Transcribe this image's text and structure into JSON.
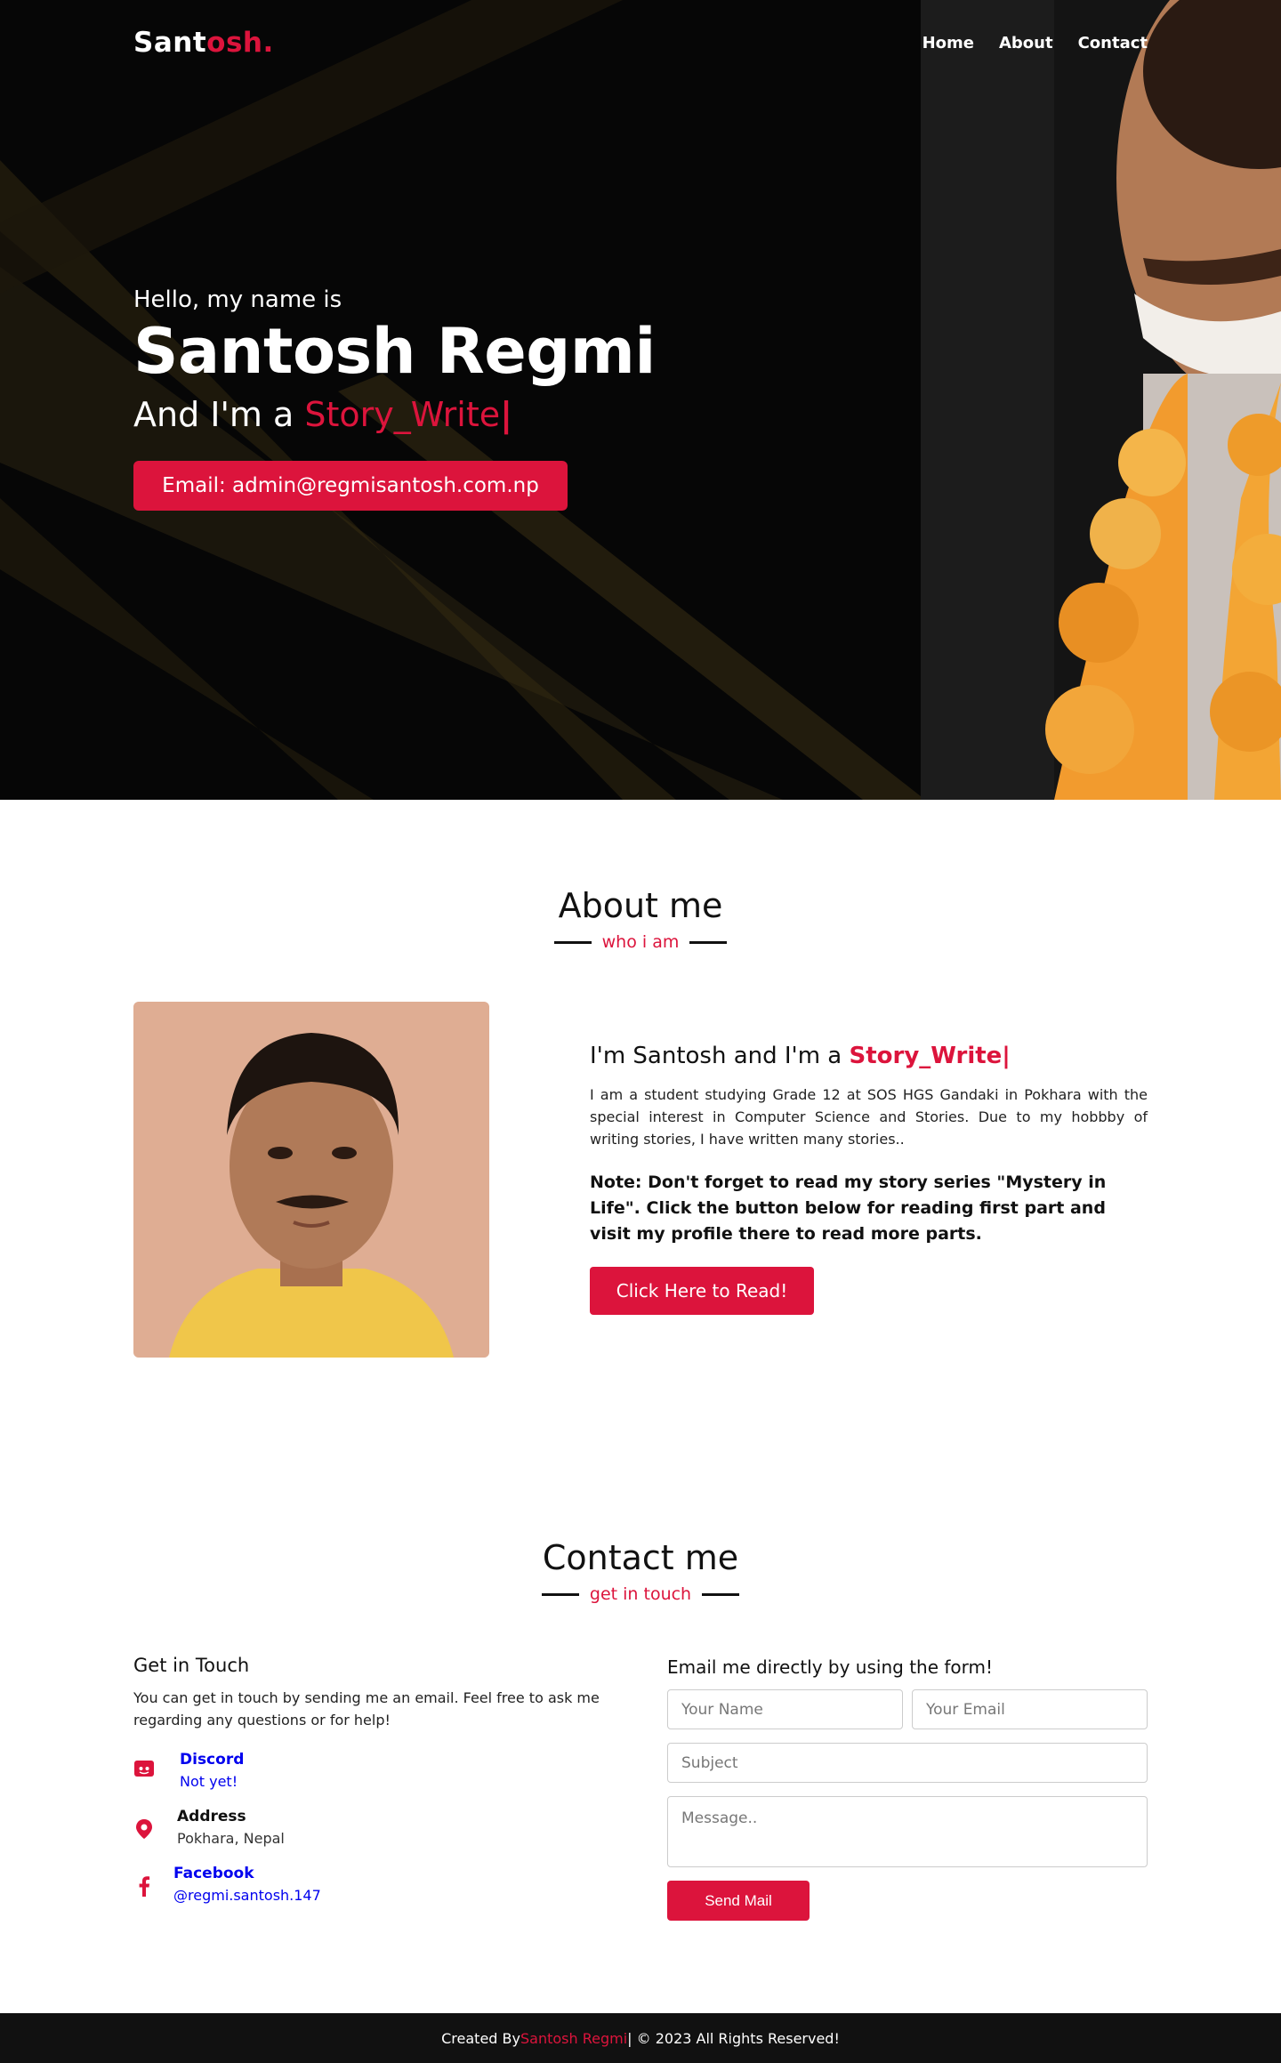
{
  "colors": {
    "accent": "#dc143c",
    "hero_bg": "#060606",
    "footer_bg": "#111111"
  },
  "nav": {
    "brand_main": "Sant",
    "brand_accent": "osh.",
    "links": [
      "Home",
      "About",
      "Contact"
    ]
  },
  "hero": {
    "greeting": "Hello, my name is",
    "name": "Santosh Regmi",
    "role_prefix": "And I'm a ",
    "role_typed": "Story_Write",
    "caret": "|",
    "email_button": "Email: admin@regmisantosh.com.np"
  },
  "about": {
    "title": "About me",
    "subtitle": "who i am",
    "heading_prefix": "I'm Santosh and I'm a ",
    "heading_typed": "Story_Write|",
    "description": "I am a student studying Grade 12 at SOS HGS Gandaki in Pokhara with the special interest in Computer Science and Stories. Due to my hobbby of writing stories, I have written many stories..",
    "note": "Note: Don't forget to read my story series \"Mystery in Life\". Click the button below for reading first part and visit my profile there to read more parts.",
    "button": "Click Here to Read!"
  },
  "contact": {
    "title": "Contact me",
    "subtitle": "get in touch",
    "left_heading": "Get in Touch",
    "intro": "You can get in touch by sending me an email. Feel free to ask me regarding any questions or for help!",
    "items": [
      {
        "icon": "discord-icon",
        "head": "Discord",
        "value": "Not yet!"
      },
      {
        "icon": "map-pin-icon",
        "head": "Address",
        "value": "Pokhara, Nepal"
      },
      {
        "icon": "facebook-icon",
        "head": "Facebook",
        "value": "@regmi.santosh.147"
      }
    ],
    "form_heading": "Email me directly by using the form!",
    "placeholders": {
      "name": "Your Name",
      "email": "Your Email",
      "subject": "Subject",
      "message": "Message.."
    },
    "send_button": "Send Mail"
  },
  "footer": {
    "prefix": "Created By ",
    "author": "Santosh Regmi",
    "suffix": " | © 2023 All Rights Reserved!"
  }
}
